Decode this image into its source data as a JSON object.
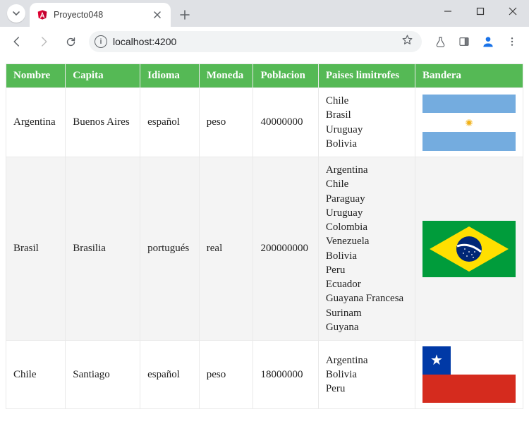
{
  "browser": {
    "tab_title": "Proyecto048",
    "url": "localhost:4200"
  },
  "table": {
    "headers": [
      "Nombre",
      "Capita",
      "Idioma",
      "Moneda",
      "Poblacion",
      "Paises limitrofes",
      "Bandera"
    ],
    "rows": [
      {
        "nombre": "Argentina",
        "capital": "Buenos Aires",
        "idioma": "español",
        "moneda": "peso",
        "poblacion": "40000000",
        "limitrofes": [
          "Chile",
          "Brasil",
          "Uruguay",
          "Bolivia"
        ],
        "flag": "argentina"
      },
      {
        "nombre": "Brasil",
        "capital": "Brasilia",
        "idioma": "portugués",
        "moneda": "real",
        "poblacion": "200000000",
        "limitrofes": [
          "Argentina",
          "Chile",
          "Paraguay",
          "Uruguay",
          "Colombia",
          "Venezuela",
          "Bolivia",
          "Peru",
          "Ecuador",
          "Guayana Francesa",
          "Surinam",
          "Guyana"
        ],
        "flag": "brasil"
      },
      {
        "nombre": "Chile",
        "capital": "Santiago",
        "idioma": "español",
        "moneda": "peso",
        "poblacion": "18000000",
        "limitrofes": [
          "Argentina",
          "Bolivia",
          "Peru"
        ],
        "flag": "chile"
      }
    ]
  }
}
